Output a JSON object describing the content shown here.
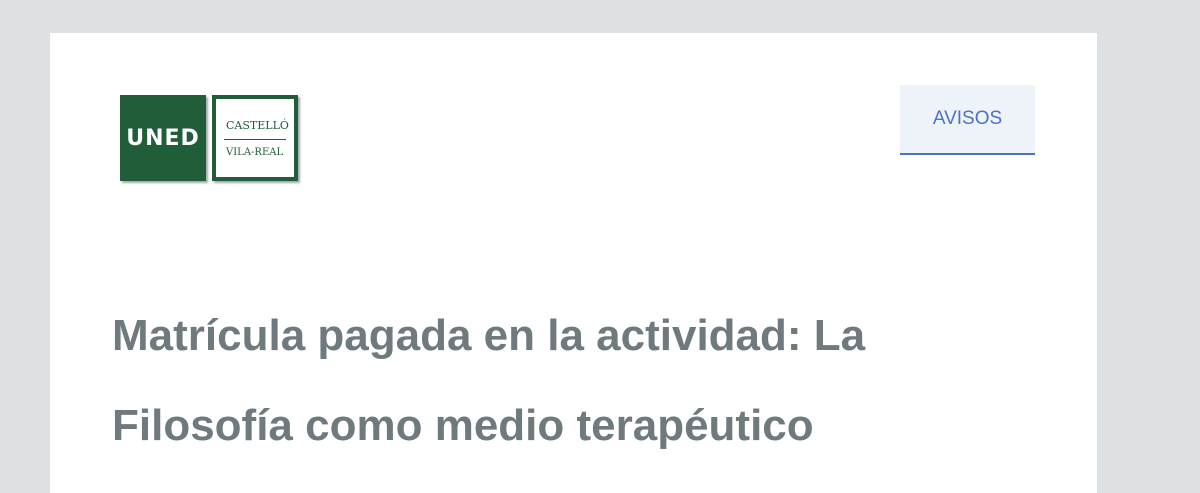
{
  "header": {
    "logo": {
      "brand": "UNED",
      "center_line1": "CASTELLÓ",
      "center_line2": "VILA-REAL",
      "brand_color": "#1f5e38"
    },
    "nav_link": "AVISOS"
  },
  "main": {
    "headline": "Matrícula pagada en la actividad: La Filosofía como medio terapéutico"
  }
}
